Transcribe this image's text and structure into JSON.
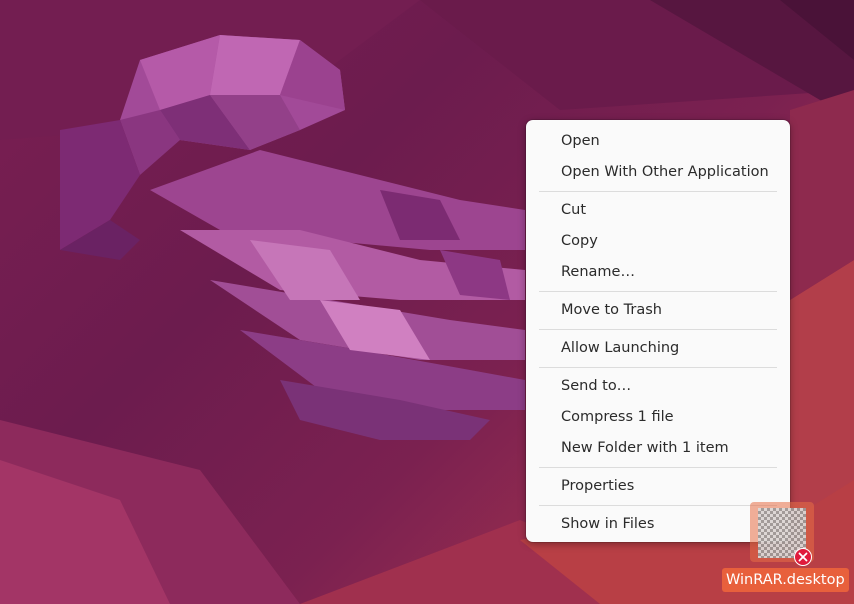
{
  "context_menu": {
    "groups": [
      [
        {
          "label": "Open"
        },
        {
          "label": "Open With Other Application"
        }
      ],
      [
        {
          "label": "Cut"
        },
        {
          "label": "Copy"
        },
        {
          "label": "Rename…"
        }
      ],
      [
        {
          "label": "Move to Trash"
        }
      ],
      [
        {
          "label": "Allow Launching"
        }
      ],
      [
        {
          "label": "Send to…"
        },
        {
          "label": "Compress 1 file"
        },
        {
          "label": "New Folder with 1 item"
        }
      ],
      [
        {
          "label": "Properties"
        }
      ],
      [
        {
          "label": "Show in Files"
        }
      ]
    ]
  },
  "desktop_icon": {
    "label": "WinRAR.desktop",
    "icon": "desktop-file-icon",
    "badge_icon": "error-badge-icon",
    "selected": true
  },
  "colors": {
    "wallpaper_base": "#6c1c4e",
    "wallpaper_accent": "#c44a3e",
    "jellyfish": "#9b3f8f",
    "menu_bg": "#fafafa",
    "selection": "#e8603c",
    "error_badge": "#e01b3c"
  }
}
